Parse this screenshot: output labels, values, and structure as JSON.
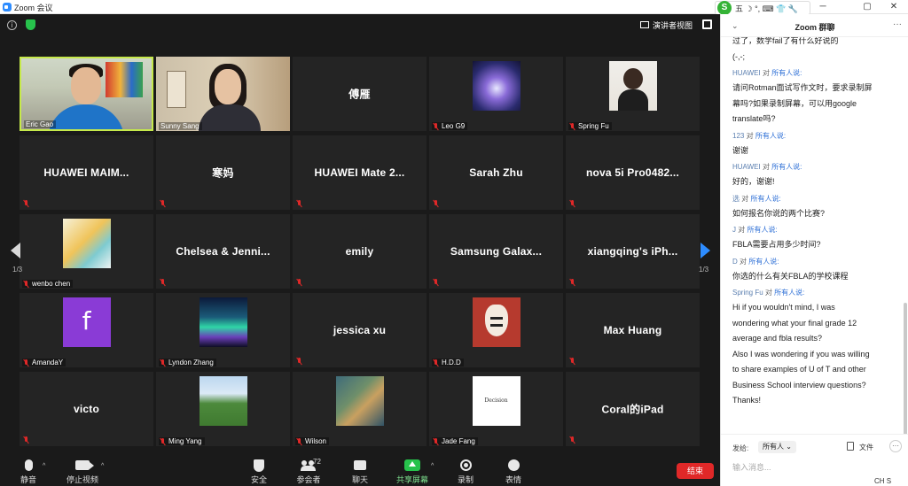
{
  "window": {
    "title": "Zoom 会议",
    "minimize": "─",
    "maximize": "▢",
    "close": "✕"
  },
  "ime": {
    "logo": "S",
    "chars": "五 ☽ °, ⌨ 👕 🔧"
  },
  "meeting": {
    "info_glyph": "i",
    "speaker_view": "演讲者视图",
    "page_left": "1/3",
    "page_right": "1/3",
    "tiles": [
      {
        "name": "Eric Gao",
        "kind": "video-eric",
        "active": true,
        "muted": false
      },
      {
        "name": "Sunny Sang",
        "kind": "video-sunny",
        "active": false,
        "muted": false
      },
      {
        "name": "傅雁",
        "kind": "text",
        "muted": false
      },
      {
        "name": "Leo G9",
        "kind": "avatar",
        "avatar": "leo",
        "muted": true
      },
      {
        "name": "Spring Fu",
        "kind": "avatar",
        "avatar": "spring",
        "muted": true
      },
      {
        "name": "HUAWEI  MAIM...",
        "kind": "text",
        "muted": true
      },
      {
        "name": "寒妈",
        "kind": "text",
        "muted": true
      },
      {
        "name": "HUAWEI  Mate  2...",
        "kind": "text",
        "muted": true
      },
      {
        "name": "Sarah  Zhu",
        "kind": "text",
        "muted": true
      },
      {
        "name": "nova  5i  Pro0482...",
        "kind": "text",
        "muted": true
      },
      {
        "name": "wenbo chen",
        "kind": "avatar",
        "avatar": "shell",
        "muted": true
      },
      {
        "name": "Chelsea  &  Jenni...",
        "kind": "text",
        "muted": true
      },
      {
        "name": "emily",
        "kind": "text",
        "muted": true
      },
      {
        "name": "Samsung  Galax...",
        "kind": "text",
        "muted": true
      },
      {
        "name": "xiangqing's  iPh...",
        "kind": "text",
        "muted": true
      },
      {
        "name": "AmandaY",
        "kind": "avatar",
        "avatar": "f",
        "avatar_text": "f",
        "muted": true
      },
      {
        "name": "Lyndon Zhang",
        "kind": "avatar",
        "avatar": "aurora",
        "muted": true
      },
      {
        "name": "jessica  xu",
        "kind": "text",
        "muted": true
      },
      {
        "name": "H.D.D",
        "kind": "avatar",
        "avatar": "mask",
        "muted": true
      },
      {
        "name": "Max  Huang",
        "kind": "text",
        "muted": true
      },
      {
        "name": "victo",
        "kind": "text",
        "muted": true
      },
      {
        "name": "Ming Yang",
        "kind": "avatar",
        "avatar": "forest",
        "muted": true
      },
      {
        "name": "Wilson",
        "kind": "avatar",
        "avatar": "map",
        "muted": true
      },
      {
        "name": "Jade Fang",
        "kind": "avatar",
        "avatar": "doc",
        "avatar_text": "Decision",
        "muted": true
      },
      {
        "name": "Coral的iPad",
        "kind": "text",
        "muted": true
      }
    ]
  },
  "toolbar": {
    "mute": "静音",
    "stop_video": "停止视频",
    "security": "安全",
    "participants": "参会者",
    "participants_count": "72",
    "chat": "聊天",
    "share_screen": "共享屏幕",
    "record": "录制",
    "reactions": "表情",
    "end": "结束",
    "caret": "^"
  },
  "chat": {
    "chevron": "⌄",
    "title": "Zoom 群聊",
    "more": "···",
    "messages": [
      {
        "sender": "",
        "to": "",
        "all": "",
        "lines": [
          "过了，数学fail了有什么好说的",
          "(-,-;"
        ]
      },
      {
        "sender": "HUAWEI",
        "to": "对",
        "all": "所有人说:",
        "lines": [
          "请问Rotman面试写作文时，要求录制屏",
          "幕吗?如果录制屏幕，可以用google",
          "translate吗?"
        ]
      },
      {
        "sender": "123",
        "to": "对",
        "all": "所有人说:",
        "lines": [
          "谢谢"
        ]
      },
      {
        "sender": "HUAWEI",
        "to": "对",
        "all": "所有人说:",
        "lines": [
          "好的，谢谢!"
        ]
      },
      {
        "sender": "选",
        "to": "对",
        "all": "所有人说:",
        "lines": [
          "如何报名你说的两个比赛?"
        ]
      },
      {
        "sender": "J",
        "to": "对",
        "all": "所有人说:",
        "lines": [
          "FBLA需要占用多少时间?"
        ]
      },
      {
        "sender": "D",
        "to": "对",
        "all": "所有人说:",
        "lines": [
          "你选的什么有关FBLA的学校课程"
        ]
      },
      {
        "sender": "Spring Fu",
        "to": "对",
        "all": "所有人说:",
        "lines": [
          "Hi if you wouldn't mind, I was",
          "wondering what your final grade 12",
          "average and fbla results?",
          "Also I was wondering if you was willing",
          "to share examples of U of T and other",
          "Business School interview questions?",
          "Thanks!"
        ]
      }
    ],
    "send_to": "发给:",
    "recipient": "所有人 ⌄",
    "file": "文件",
    "more_btn": "···",
    "input_placeholder": "输入消息..."
  },
  "ime_status": "CH S"
}
